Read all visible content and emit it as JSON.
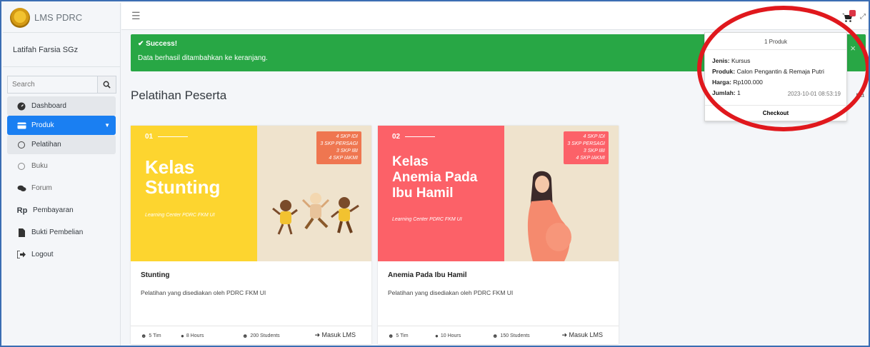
{
  "brand": {
    "title": "LMS PDRC"
  },
  "user": {
    "name": "Latifah Farsia SGz"
  },
  "search": {
    "placeholder": "Search",
    "icon": "search-icon"
  },
  "sidebar": {
    "items": [
      {
        "label": "Dashboard",
        "icon": "tachometer-icon"
      },
      {
        "label": "Produk",
        "icon": "credit-card-icon"
      },
      {
        "label": "Pelatihan",
        "icon": "circle-icon"
      },
      {
        "label": "Buku",
        "icon": "circle-icon"
      },
      {
        "label": "Forum",
        "icon": "comments-icon"
      },
      {
        "label": "Pembayaran",
        "icon": "rupiah-icon",
        "icon_text": "Rp"
      },
      {
        "label": "Bukti Pembelian",
        "icon": "file-icon"
      },
      {
        "label": "Logout",
        "icon": "sign-out-icon"
      }
    ]
  },
  "alert": {
    "title": "✔ Success!",
    "message": "Data berhasil ditambahkan ke keranjang.",
    "close": "×",
    "color": "#28a745"
  },
  "page": {
    "title": "Pelatihan Peserta",
    "crumb_tail": "rta"
  },
  "cards": [
    {
      "number": "01",
      "banner_title_1": "Kelas",
      "banner_title_2": "Stunting",
      "banner_sub": "Learning Center PDRC FKM UI",
      "skp": [
        "4 SKP IDI",
        "3 SKP PERSAGI",
        "3 SKP IBI",
        "4 SKP IAKMI"
      ],
      "banner_color": "#fdd52f",
      "title": "Stunting",
      "desc": "Pelatihan yang disediakan oleh PDRC FKM UI",
      "team": "5 Tim",
      "hours": "8 Hours",
      "students": "200 Students",
      "action": "Masuk LMS"
    },
    {
      "number": "02",
      "banner_title_1": "Kelas",
      "banner_title_2": "Anemia Pada",
      "banner_title_3": "Ibu Hamil",
      "banner_sub": "Learning Center PDRC FKM UI",
      "skp": [
        "4 SKP IDI",
        "3 SKP PERSAGI",
        "3 SKP IBI",
        "4 SKP IAKMI"
      ],
      "banner_color": "#fc6168",
      "title": "Anemia Pada Ibu Hamil",
      "desc": "Pelatihan yang disediakan oleh PDRC FKM UI",
      "team": "5 Tim",
      "hours": "10 Hours",
      "students": "150 Students",
      "action": "Masuk LMS"
    }
  ],
  "cart": {
    "header": "1 Produk",
    "jenis_label": "Jenis:",
    "jenis": "Kursus",
    "produk_label": "Produk:",
    "produk": "Calon Pengantin & Remaja Putri",
    "harga_label": "Harga:",
    "harga": "Rp100.000",
    "jumlah_label": "Jumlah:",
    "jumlah": "1",
    "date": "2023-10-01 08:53:19",
    "checkout": "Checkout"
  }
}
